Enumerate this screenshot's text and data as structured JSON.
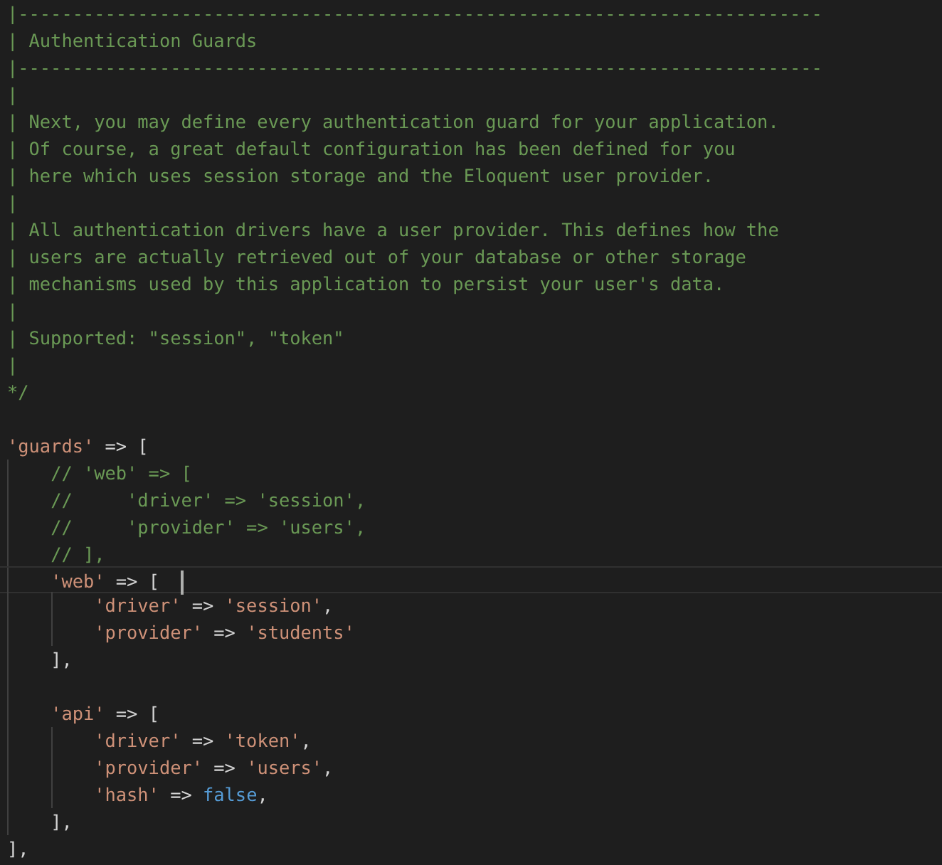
{
  "editor": {
    "lines": [
      {
        "current": false,
        "tokens": [
          {
            "kind": "comment",
            "text": "|--------------------------------------------------------------------------"
          }
        ]
      },
      {
        "current": false,
        "tokens": [
          {
            "kind": "comment",
            "text": "| Authentication Guards"
          }
        ]
      },
      {
        "current": false,
        "tokens": [
          {
            "kind": "comment",
            "text": "|--------------------------------------------------------------------------"
          }
        ]
      },
      {
        "current": false,
        "tokens": [
          {
            "kind": "comment",
            "text": "|"
          }
        ]
      },
      {
        "current": false,
        "tokens": [
          {
            "kind": "comment",
            "text": "| Next, you may define every authentication guard for your application."
          }
        ]
      },
      {
        "current": false,
        "tokens": [
          {
            "kind": "comment",
            "text": "| Of course, a great default configuration has been defined for you"
          }
        ]
      },
      {
        "current": false,
        "tokens": [
          {
            "kind": "comment",
            "text": "| here which uses session storage and the Eloquent user provider."
          }
        ]
      },
      {
        "current": false,
        "tokens": [
          {
            "kind": "comment",
            "text": "|"
          }
        ]
      },
      {
        "current": false,
        "tokens": [
          {
            "kind": "comment",
            "text": "| All authentication drivers have a user provider. This defines how the"
          }
        ]
      },
      {
        "current": false,
        "tokens": [
          {
            "kind": "comment",
            "text": "| users are actually retrieved out of your database or other storage"
          }
        ]
      },
      {
        "current": false,
        "tokens": [
          {
            "kind": "comment",
            "text": "| mechanisms used by this application to persist your user's data."
          }
        ]
      },
      {
        "current": false,
        "tokens": [
          {
            "kind": "comment",
            "text": "|"
          }
        ]
      },
      {
        "current": false,
        "tokens": [
          {
            "kind": "comment",
            "text": "| Supported: \"session\", \"token\""
          }
        ]
      },
      {
        "current": false,
        "tokens": [
          {
            "kind": "comment",
            "text": "|"
          }
        ]
      },
      {
        "current": false,
        "tokens": [
          {
            "kind": "comment",
            "text": "*/"
          }
        ]
      },
      {
        "current": false
      },
      {
        "current": false,
        "tokens": [
          {
            "kind": "string",
            "text": "'guards'"
          },
          {
            "kind": "operator",
            "text": " => "
          },
          {
            "kind": "punct",
            "text": "["
          }
        ]
      },
      {
        "current": false,
        "tokens": [
          {
            "kind": "comment",
            "text": "    // 'web' => ["
          }
        ]
      },
      {
        "current": false,
        "tokens": [
          {
            "kind": "comment",
            "text": "    //     'driver' => 'session',"
          }
        ]
      },
      {
        "current": false,
        "tokens": [
          {
            "kind": "comment",
            "text": "    //     'provider' => 'users',"
          }
        ]
      },
      {
        "current": false,
        "tokens": [
          {
            "kind": "comment",
            "text": "    // ],"
          }
        ]
      },
      {
        "current": true,
        "tokens": [
          {
            "kind": "string",
            "text": "    'web'"
          },
          {
            "kind": "operator",
            "text": " => "
          },
          {
            "kind": "punct",
            "text": "["
          }
        ]
      },
      {
        "current": false,
        "tokens": [
          {
            "kind": "string",
            "text": "        'driver'"
          },
          {
            "kind": "operator",
            "text": " => "
          },
          {
            "kind": "string",
            "text": "'session'"
          },
          {
            "kind": "punct",
            "text": ","
          }
        ]
      },
      {
        "current": false,
        "tokens": [
          {
            "kind": "string",
            "text": "        'provider'"
          },
          {
            "kind": "operator",
            "text": " => "
          },
          {
            "kind": "string",
            "text": "'students'"
          }
        ]
      },
      {
        "current": false,
        "tokens": [
          {
            "kind": "punct",
            "text": "    ],"
          }
        ]
      },
      {
        "current": false
      },
      {
        "current": false,
        "tokens": [
          {
            "kind": "string",
            "text": "    'api'"
          },
          {
            "kind": "operator",
            "text": " => "
          },
          {
            "kind": "punct",
            "text": "["
          }
        ]
      },
      {
        "current": false,
        "tokens": [
          {
            "kind": "string",
            "text": "        'driver'"
          },
          {
            "kind": "operator",
            "text": " => "
          },
          {
            "kind": "string",
            "text": "'token'"
          },
          {
            "kind": "punct",
            "text": ","
          }
        ]
      },
      {
        "current": false,
        "tokens": [
          {
            "kind": "string",
            "text": "        'provider'"
          },
          {
            "kind": "operator",
            "text": " => "
          },
          {
            "kind": "string",
            "text": "'users'"
          },
          {
            "kind": "punct",
            "text": ","
          }
        ]
      },
      {
        "current": false,
        "tokens": [
          {
            "kind": "string",
            "text": "        'hash'"
          },
          {
            "kind": "operator",
            "text": " => "
          },
          {
            "kind": "keyword",
            "text": "false"
          },
          {
            "kind": "punct",
            "text": ","
          }
        ]
      },
      {
        "current": false,
        "tokens": [
          {
            "kind": "punct",
            "text": "    ],"
          }
        ]
      },
      {
        "current": false,
        "tokens": [
          {
            "kind": "punct",
            "text": "],"
          }
        ]
      }
    ]
  }
}
